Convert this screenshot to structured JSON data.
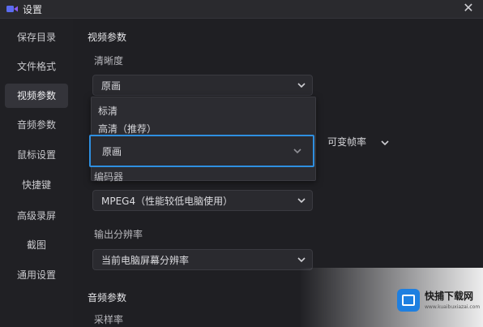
{
  "window": {
    "title": "设置",
    "close_symbol": "✕"
  },
  "sidebar": {
    "items": [
      {
        "label": "保存目录",
        "active": false
      },
      {
        "label": "文件格式",
        "active": false
      },
      {
        "label": "视频参数",
        "active": true
      },
      {
        "label": "音频参数",
        "active": false
      },
      {
        "label": "鼠标设置",
        "active": false
      },
      {
        "label": "快捷键",
        "active": false
      },
      {
        "label": "高级录屏",
        "active": false
      },
      {
        "label": "截图",
        "active": false
      },
      {
        "label": "通用设置",
        "active": false
      }
    ]
  },
  "video": {
    "section_title": "视频参数",
    "quality_label": "清晰度",
    "quality_value": "原画",
    "quality_options": [
      "标清",
      "高清（推荐）",
      "原画"
    ],
    "framerate_value": "可变帧率",
    "encoder_label": "编码器",
    "encoder_value": "MPEG4（性能较低电脑使用）",
    "resolution_label": "输出分辨率",
    "resolution_value": "当前电脑屏幕分辨率"
  },
  "audio": {
    "section_title": "音频参数",
    "samplerate_label": "采样率"
  },
  "watermark": {
    "name": "快捕下载网",
    "sub": "www.kuaibuxiazai.com"
  },
  "colors": {
    "accent": "#2f8fe0",
    "background": "#1f1f23",
    "sidebar_active": "#34343a"
  },
  "icons": {
    "app": "video-camera-icon",
    "close": "close-icon",
    "chevron": "chevron-down-icon"
  }
}
